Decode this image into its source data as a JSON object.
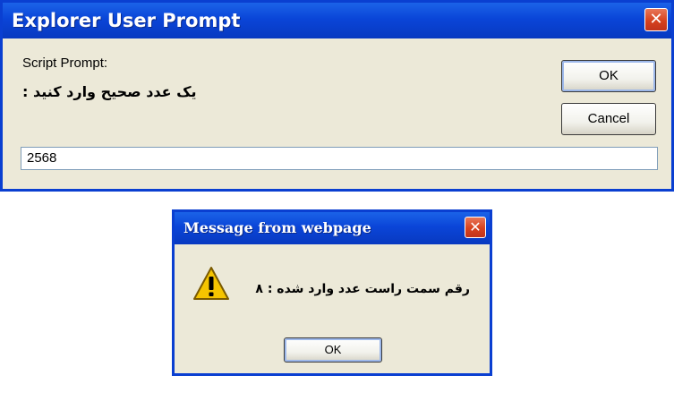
{
  "prompt_dialog": {
    "title": "Explorer User Prompt",
    "close_icon": "close-icon",
    "label": "Script Prompt:",
    "question": "یک عدد صحیح وارد کنید :",
    "ok_label": "OK",
    "cancel_label": "Cancel",
    "input_value": "2568"
  },
  "message_dialog": {
    "title": "Message from webpage",
    "close_icon": "close-icon",
    "icon": "warning-icon",
    "message": "رقم سمت راست عدد وارد شده : ۸",
    "ok_label": "OK"
  },
  "colors": {
    "titlebar": "#0a45d8",
    "dialog_bg": "#ece9d8",
    "close_btn": "#d7421e",
    "warning": "#f5c400"
  }
}
